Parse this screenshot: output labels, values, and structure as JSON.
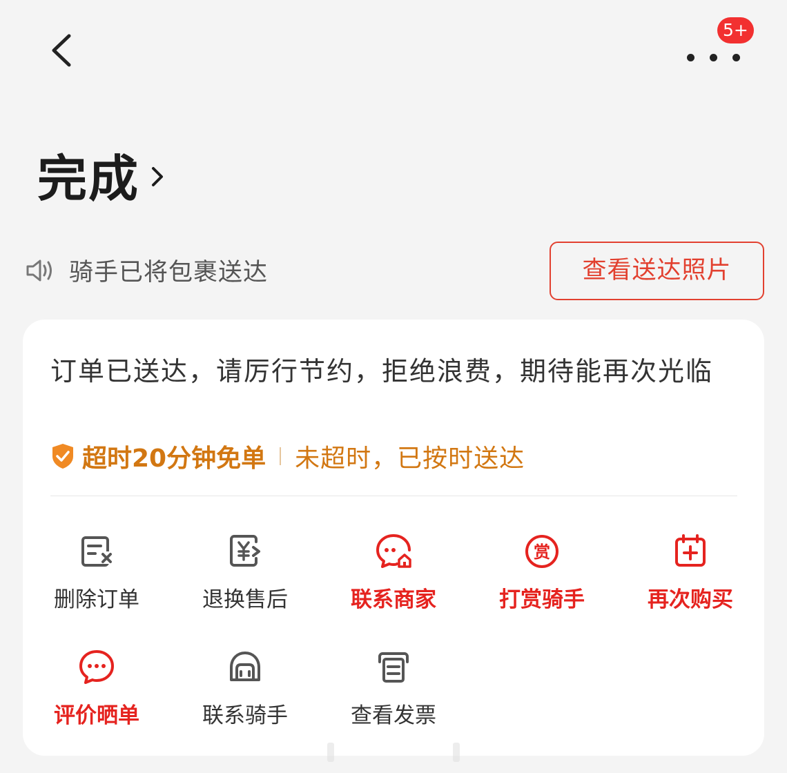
{
  "nav": {
    "back_icon": "chevron-left-icon",
    "more_icon": "more-dots-icon",
    "message_badge": "5+"
  },
  "status": {
    "title": "完成",
    "chevron_icon": "chevron-right-icon"
  },
  "notice": {
    "speaker_icon": "speaker-icon",
    "text": "骑手已将包裹送达",
    "photo_button": "查看送达照片"
  },
  "card": {
    "message": "订单已送达，请厉行节约，拒绝浪费，期待能再次光临",
    "guarantee": {
      "shield_icon": "shield-check-icon",
      "title": "超时20分钟免单",
      "description": "未超时，已按时送达"
    },
    "actions": [
      {
        "label": "删除订单",
        "icon": "delete-order-icon",
        "highlight": false
      },
      {
        "label": "退换售后",
        "icon": "refund-yen-icon",
        "highlight": false
      },
      {
        "label": "联系商家",
        "icon": "merchant-chat-icon",
        "highlight": true
      },
      {
        "label": "打赏骑手",
        "icon": "reward-icon",
        "highlight": true
      },
      {
        "label": "再次购买",
        "icon": "buy-again-icon",
        "highlight": true
      },
      {
        "label": "评价晒单",
        "icon": "comment-icon",
        "highlight": true
      },
      {
        "label": "联系骑手",
        "icon": "rider-helmet-icon",
        "highlight": false
      },
      {
        "label": "查看发票",
        "icon": "invoice-icon",
        "highlight": false
      }
    ]
  },
  "colors": {
    "accent_red": "#e5231f",
    "guarantee_orange": "#d27712",
    "background": "#f4f4f4",
    "card": "#ffffff"
  }
}
